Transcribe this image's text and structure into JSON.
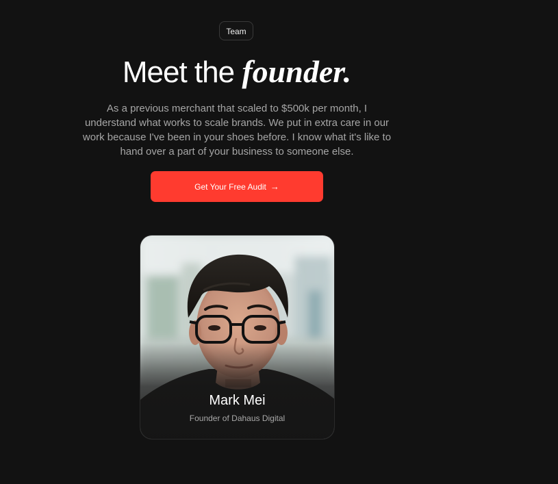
{
  "section": {
    "badge": "Team",
    "title_plain": "Meet the",
    "title_italic": "founder.",
    "description": "As a previous merchant that scaled to $500k per month, I understand what works to scale brands. We put in extra care in our work because I've been in your shoes before. I know what it's like to hand over a part of your business to someone else.",
    "cta_label": "Get Your Free Audit",
    "cta_icon": "arrow-right-icon"
  },
  "founder": {
    "name": "Mark Mei",
    "role": "Founder of Dahaus Digital",
    "photo_icon": "founder-portrait"
  },
  "colors": {
    "background": "#121212",
    "accent": "#ff3b2f",
    "text_primary": "#ffffff",
    "text_secondary": "#a6a6a6"
  }
}
